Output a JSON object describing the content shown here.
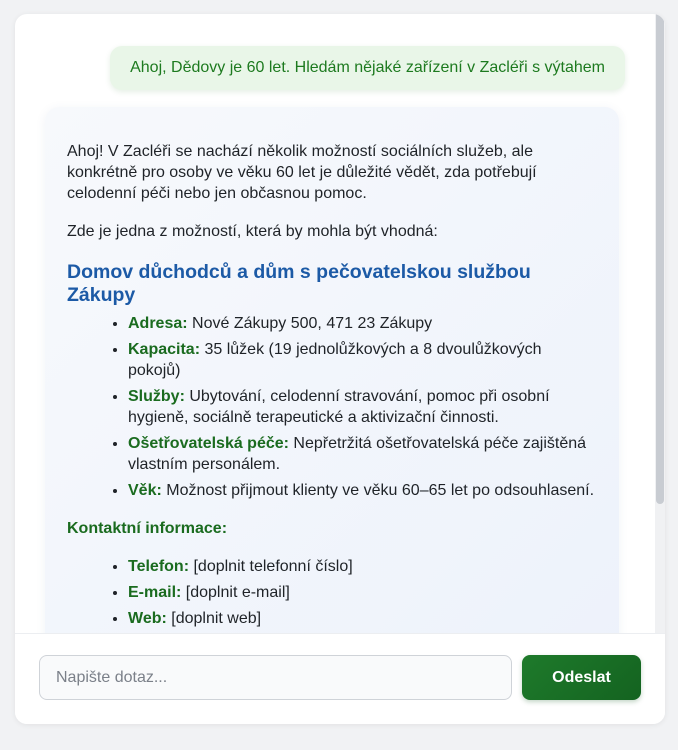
{
  "conversation": {
    "user_message": "Ahoj, Dědovy je 60 let. Hledám nějaké zařízení v Zacléři s výtahem",
    "bot": {
      "intro": "Ahoj! V Zacléři se nachází několik možností sociálních služeb, ale konkrétně pro osoby ve věku 60 let je důležité vědět, zda potřebují celodenní péči nebo jen občasnou pomoc.",
      "lead": "Zde je jedna z možností, která by mohla být vhodná:",
      "facility_title": "Domov důchodců a dům s pečovatelskou službou Zákupy",
      "details": [
        {
          "label": "Adresa:",
          "value": " Nové Zákupy 500, 471 23 Zákupy"
        },
        {
          "label": "Kapacita:",
          "value": " 35 lůžek (19 jednolůžkových a 8 dvoulůžkových pokojů)"
        },
        {
          "label": "Služby:",
          "value": " Ubytování, celodenní stravování, pomoc při osobní hygieně, sociálně terapeutické a aktivizační činnosti."
        },
        {
          "label": "Ošetřovatelská péče:",
          "value": " Nepřetržitá ošetřovatelská péče zajištěná vlastním personálem."
        },
        {
          "label": "Věk:",
          "value": " Možnost přijmout klienty ve věku 60–65 let po odsouhlasení."
        }
      ],
      "contact_heading": "Kontaktní informace:",
      "contacts": [
        {
          "label": "Telefon:",
          "value": " [doplnit telefonní číslo]"
        },
        {
          "label": "E-mail:",
          "value": " [doplnit e-mail]"
        },
        {
          "label": "Web:",
          "value": " [doplnit web]"
        }
      ]
    }
  },
  "composer": {
    "placeholder": "Napište dotaz...",
    "send_label": "Odeslat"
  }
}
